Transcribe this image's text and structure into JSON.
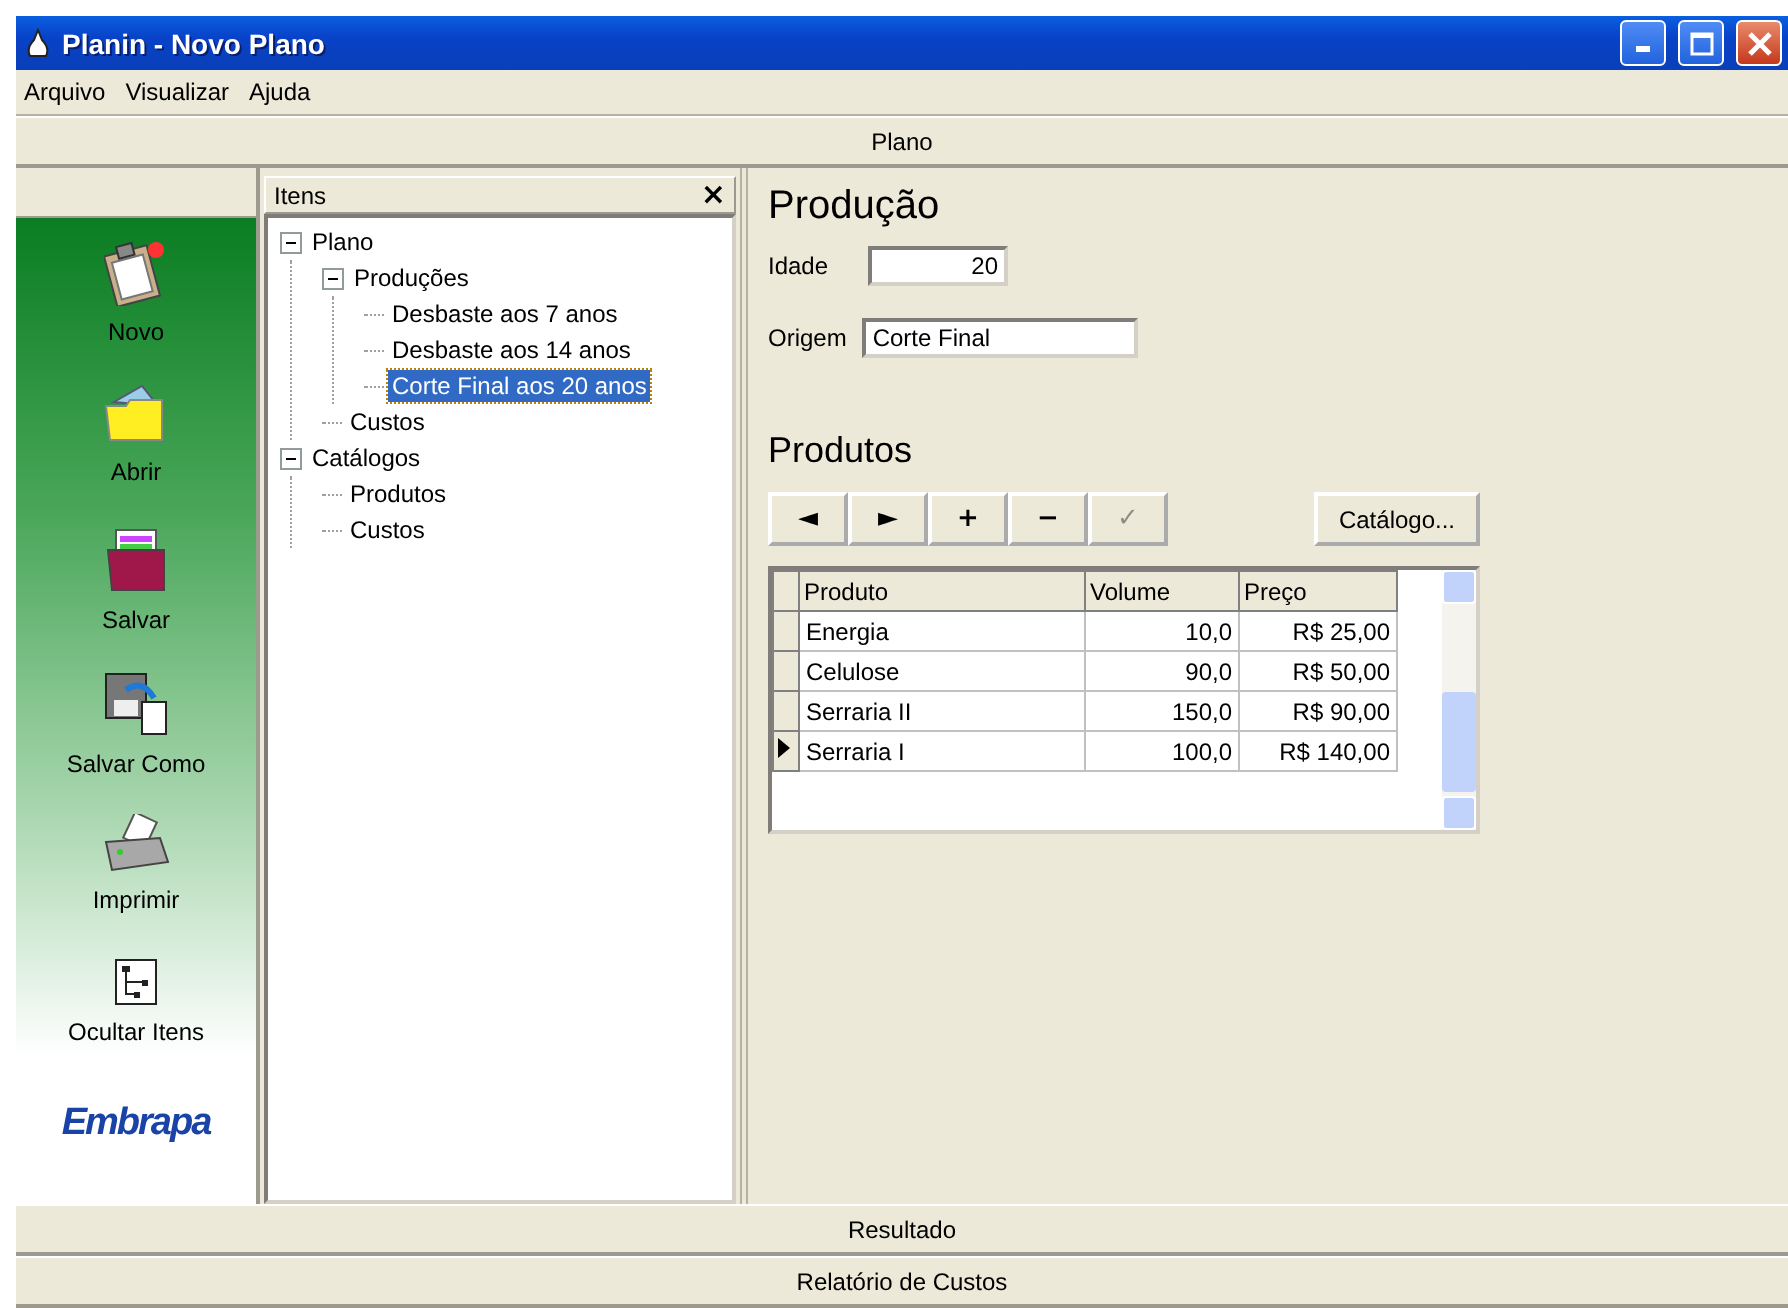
{
  "window": {
    "title": "Planin - Novo Plano"
  },
  "menu": [
    "Arquivo",
    "Visualizar",
    "Ajuda"
  ],
  "top_bar": "Plano",
  "sidebar": {
    "items": [
      {
        "kind": "new",
        "label": "Novo"
      },
      {
        "kind": "open",
        "label": "Abrir"
      },
      {
        "kind": "save",
        "label": "Salvar"
      },
      {
        "kind": "saveas",
        "label": "Salvar Como"
      },
      {
        "kind": "print",
        "label": "Imprimir"
      },
      {
        "kind": "hide",
        "label": "Ocultar Itens"
      }
    ],
    "logo": "Embrapa"
  },
  "tree_panel": {
    "title": "Itens",
    "close": "×",
    "items": [
      {
        "label": "Plano",
        "expanded": true,
        "selected": false,
        "children": [
          {
            "label": "Produções",
            "expanded": true,
            "selected": false,
            "children": [
              {
                "label": "Desbaste aos 7 anos",
                "selected": false
              },
              {
                "label": "Desbaste aos 14 anos",
                "selected": false
              },
              {
                "label": "Corte Final aos 20 anos",
                "selected": true
              }
            ]
          },
          {
            "label": "Custos",
            "selected": false
          }
        ]
      },
      {
        "label": "Catálogos",
        "expanded": true,
        "selected": false,
        "children": [
          {
            "label": "Produtos",
            "selected": false
          },
          {
            "label": "Custos",
            "selected": false
          }
        ]
      }
    ]
  },
  "form": {
    "title": "Produção",
    "fields": [
      {
        "label": "Idade",
        "value": "20"
      },
      {
        "label": "Origem",
        "value": "Corte Final"
      }
    ]
  },
  "products": {
    "title": "Produtos",
    "toolbar": [
      {
        "label": "◄",
        "disabled": false
      },
      {
        "label": "►",
        "disabled": false
      },
      {
        "label": "+",
        "disabled": false
      },
      {
        "label": "−",
        "disabled": false
      },
      {
        "label": "✓",
        "disabled": true
      }
    ],
    "catalog_button": "Catálogo...",
    "table": {
      "columns": [
        "Produto",
        "Volume",
        "Preço"
      ],
      "rows": [
        {
          "cells": [
            "Energia",
            "10,0",
            "R$ 25,00"
          ],
          "current": false
        },
        {
          "cells": [
            "Celulose",
            "90,0",
            "R$ 50,00"
          ],
          "current": false
        },
        {
          "cells": [
            "Serraria II",
            "150,0",
            "R$ 90,00"
          ],
          "current": false
        },
        {
          "cells": [
            "Serraria I",
            "100,0",
            "R$ 140,00"
          ],
          "current": true
        }
      ]
    }
  },
  "bottom_bars": [
    "Resultado",
    "Relatório de Custos"
  ]
}
